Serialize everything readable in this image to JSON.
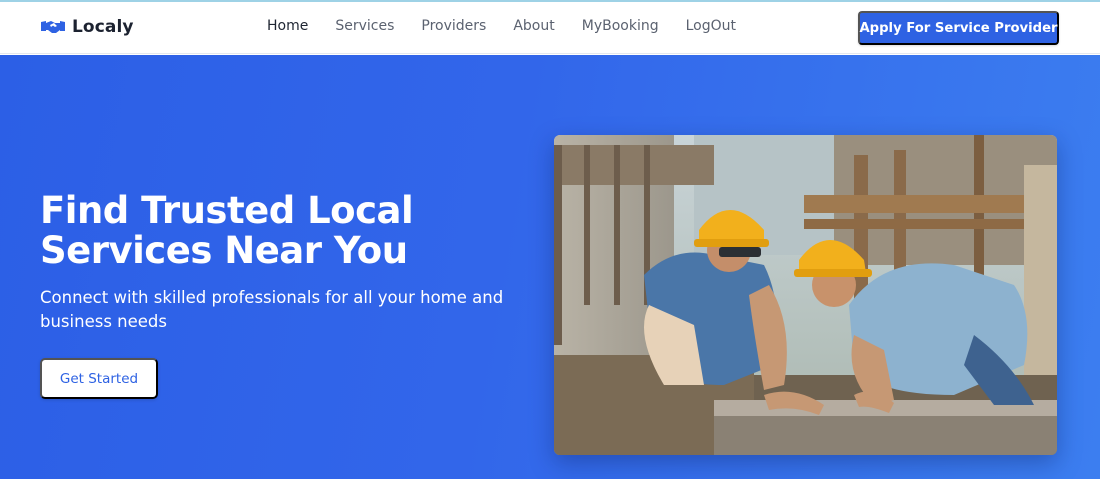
{
  "app": {
    "brand_name": "Localy",
    "brand_icon": "handshake-icon"
  },
  "nav": {
    "items": [
      {
        "label": "Home",
        "active": true
      },
      {
        "label": "Services",
        "active": false
      },
      {
        "label": "Providers",
        "active": false
      },
      {
        "label": "About",
        "active": false
      },
      {
        "label": "MyBooking",
        "active": false
      },
      {
        "label": "LogOut",
        "active": false
      }
    ],
    "apply_label": "Apply For Service Provider"
  },
  "hero": {
    "title_line1": "Find Trusted Local",
    "title_line2": "Services Near You",
    "subtitle": "Connect with skilled professionals for all your home and business needs",
    "cta_label": "Get Started",
    "image_subject": "construction-workers-photo"
  },
  "colors": {
    "primary": "#2E62E3",
    "hero_gradient_start": "#2C5FE6",
    "hero_gradient_end": "#3C7EF0",
    "nav_text": "#5B6270",
    "nav_active_text": "#1E2532",
    "white": "#FFFFFF"
  }
}
